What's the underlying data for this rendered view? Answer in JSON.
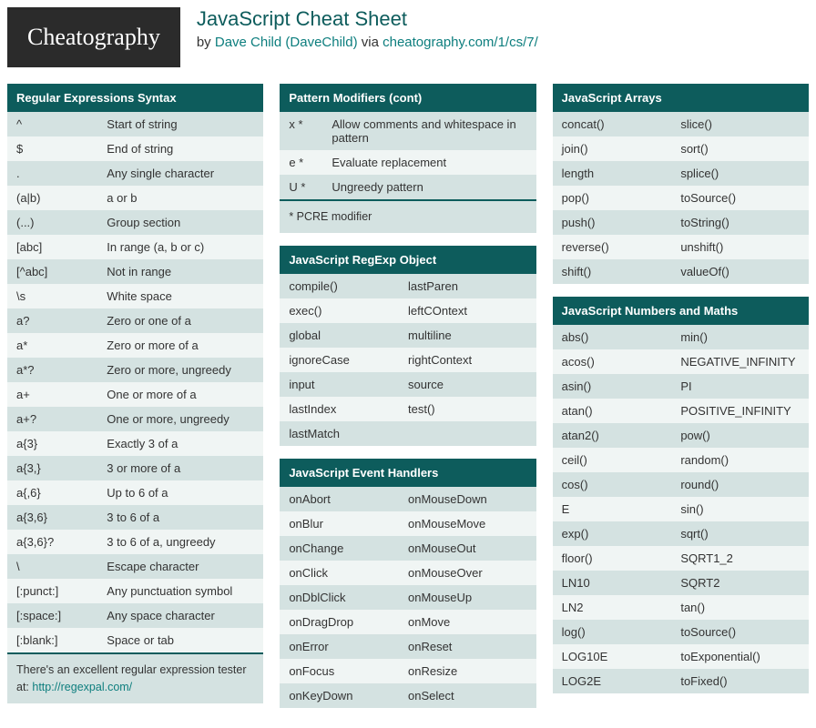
{
  "header": {
    "logo": "Cheatography",
    "title": "JavaScript Cheat Sheet",
    "by_prefix": "by ",
    "author": "Dave Child (DaveChild)",
    "via": " via ",
    "via_link": "cheatography.com/1/cs/7/"
  },
  "col1": {
    "regex": {
      "title": "Regular Expressions Syntax",
      "rows": [
        [
          "^",
          "Start of string"
        ],
        [
          "$",
          "End of string"
        ],
        [
          ".",
          "Any single character"
        ],
        [
          "(a|b)",
          "a or b"
        ],
        [
          "(...)",
          "Group section"
        ],
        [
          "[abc]",
          "In range (a, b or c)"
        ],
        [
          "[^abc]",
          "Not in range"
        ],
        [
          "\\s",
          "White space"
        ],
        [
          "a?",
          "Zero or one of a"
        ],
        [
          "a*",
          "Zero or more of a"
        ],
        [
          "a*?",
          "Zero or more, ungreedy"
        ],
        [
          "a+",
          "One or more of a"
        ],
        [
          "a+?",
          "One or more, ungreedy"
        ],
        [
          "a{3}",
          "Exactly 3 of a"
        ],
        [
          "a{3,}",
          "3 or more of a"
        ],
        [
          "a{,6}",
          "Up to 6 of a"
        ],
        [
          "a{3,6}",
          "3 to 6 of a"
        ],
        [
          "a{3,6}?",
          "3 to 6 of a, ungreedy"
        ],
        [
          "\\",
          "Escape character"
        ],
        [
          "[:punct:]",
          "Any punctuation symbol"
        ],
        [
          "[:space:]",
          "Any space character"
        ],
        [
          "[:blank:]",
          "Space or tab"
        ]
      ],
      "footnote_pre": "There's an excellent regular expression tester at: ",
      "footnote_link": "http://regexpal.com/"
    }
  },
  "col2": {
    "patmod": {
      "title": "Pattern Modifiers (cont)",
      "rows": [
        [
          "x *",
          "Allow comments and whitespace in pattern"
        ],
        [
          "e *",
          "Evaluate replacement"
        ],
        [
          "U *",
          "Ungreedy pattern"
        ]
      ],
      "footnote": "* PCRE modifier"
    },
    "regexp_obj": {
      "title": "JavaScript RegExp Object",
      "rows": [
        [
          "compile()",
          "lastParen"
        ],
        [
          "exec()",
          "leftCOntext"
        ],
        [
          "global",
          "multiline"
        ],
        [
          "ignoreCase",
          "rightContext"
        ],
        [
          "input",
          "source"
        ],
        [
          "lastIndex",
          "test()"
        ],
        [
          "lastMatch",
          ""
        ]
      ]
    },
    "events": {
      "title": "JavaScript Event Handlers",
      "rows": [
        [
          "onAbort",
          "onMouseDown"
        ],
        [
          "onBlur",
          "onMouseMove"
        ],
        [
          "onChange",
          "onMouseOut"
        ],
        [
          "onClick",
          "onMouseOver"
        ],
        [
          "onDblClick",
          "onMouseUp"
        ],
        [
          "onDragDrop",
          "onMove"
        ],
        [
          "onError",
          "onReset"
        ],
        [
          "onFocus",
          "onResize"
        ],
        [
          "onKeyDown",
          "onSelect"
        ]
      ]
    }
  },
  "col3": {
    "arrays": {
      "title": "JavaScript Arrays",
      "rows": [
        [
          "concat()",
          "slice()"
        ],
        [
          "join()",
          "sort()"
        ],
        [
          "length",
          "splice()"
        ],
        [
          "pop()",
          "toSource()"
        ],
        [
          "push()",
          "toString()"
        ],
        [
          "reverse()",
          "unshift()"
        ],
        [
          "shift()",
          "valueOf()"
        ]
      ]
    },
    "maths": {
      "title": "JavaScript Numbers and Maths",
      "rows": [
        [
          "abs()",
          "min()"
        ],
        [
          "acos()",
          "NEGATIVE_INFINITY"
        ],
        [
          "asin()",
          "PI"
        ],
        [
          "atan()",
          "POSITIVE_INFINITY"
        ],
        [
          "atan2()",
          "pow()"
        ],
        [
          "ceil()",
          "random()"
        ],
        [
          "cos()",
          "round()"
        ],
        [
          "E",
          "sin()"
        ],
        [
          "exp()",
          "sqrt()"
        ],
        [
          "floor()",
          "SQRT1_2"
        ],
        [
          "LN10",
          "SQRT2"
        ],
        [
          "LN2",
          "tan()"
        ],
        [
          "log()",
          "toSource()"
        ],
        [
          "LOG10E",
          "toExponential()"
        ],
        [
          "LOG2E",
          "toFixed()"
        ]
      ]
    }
  }
}
